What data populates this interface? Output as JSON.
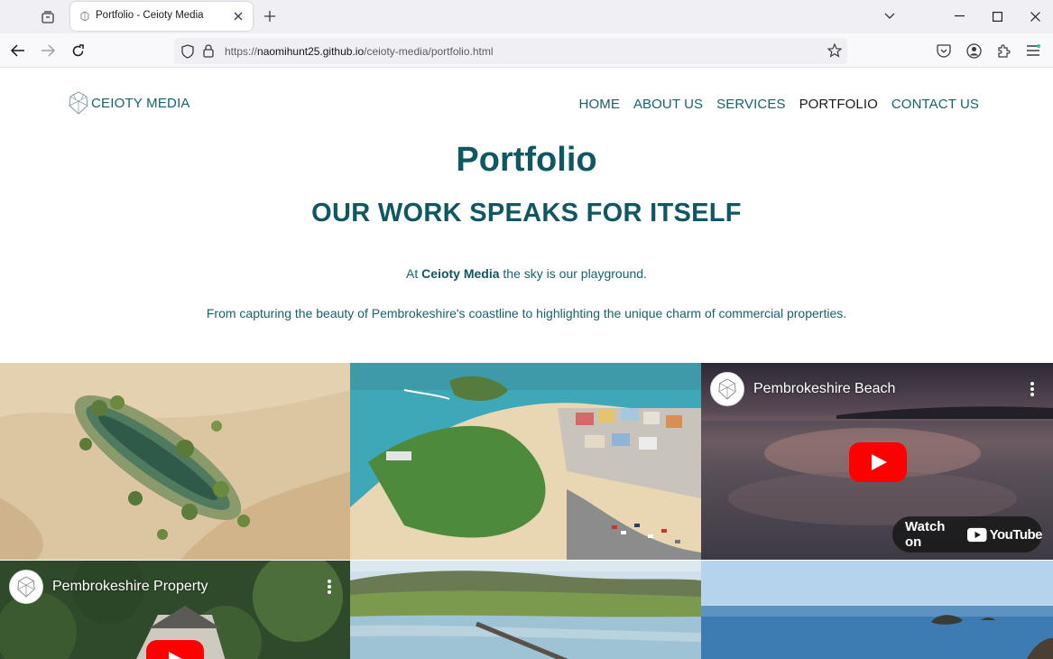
{
  "browser": {
    "tab_title": "Portfolio - Ceioty Media",
    "url_prefix": "https://",
    "url_host": "naomihunt25.github.io",
    "url_path": "/ceioty-media/portfolio.html"
  },
  "site": {
    "brand": "CEIOTY MEDIA",
    "nav": [
      {
        "label": "HOME"
      },
      {
        "label": "ABOUT US"
      },
      {
        "label": "SERVICES"
      },
      {
        "label": "PORTFOLIO",
        "active": true
      },
      {
        "label": "CONTACT US"
      }
    ]
  },
  "hero": {
    "title": "Portfolio",
    "subtitle": "OUR WORK SPEAKS FOR ITSELF",
    "intro_before": "At ",
    "intro_brand": "Ceioty Media",
    "intro_after": " the sky is our playground.",
    "description": "From capturing the beauty of Pembrokeshire's coastline to highlighting the unique charm of commercial properties."
  },
  "gallery": {
    "video1_title": "Pembrokeshire Beach",
    "video2_title": "Pembrokeshire Property",
    "watch_on": "Watch on",
    "youtube": "YouTube"
  },
  "colors": {
    "brand_teal": "#0f5763",
    "youtube_red": "#ff0000"
  }
}
